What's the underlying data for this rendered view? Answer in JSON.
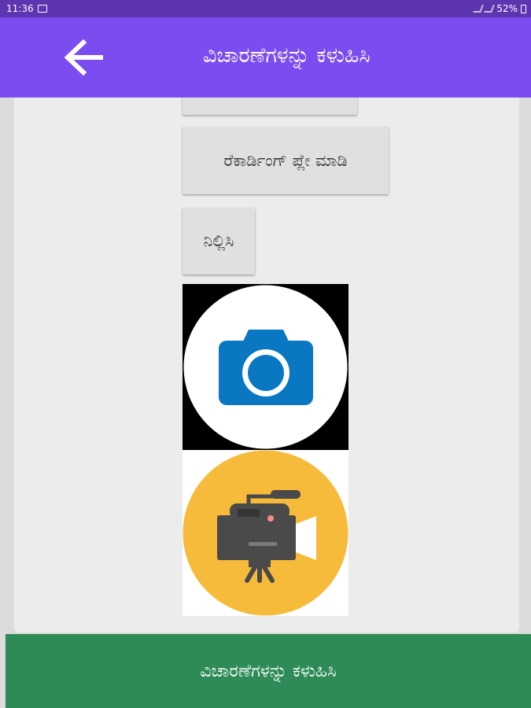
{
  "status_bar": {
    "time": "11:36",
    "battery": "52%",
    "image_icon": "image-icon",
    "wifi_icon": "wifi-icon",
    "signal_icon": "signal-icon",
    "battery_icon": "battery-icon"
  },
  "app_bar": {
    "title": "ವಿಚಾರಣೆಗಳನ್ನು ಕಳುಹಿಸಿ",
    "back_icon": "arrow-left-icon",
    "color": "#7b4cf0"
  },
  "buttons": {
    "partial_label": "",
    "play_recording": "ರೆಕಾರ್ಡಿಂಗ್ ಪ್ಲೇ ಮಾಡಿ",
    "stop": "ನಿಲ್ಲಿಸಿ"
  },
  "media": {
    "camera_icon": "camera-icon",
    "video_icon": "video-camera-icon"
  },
  "bottom_button": {
    "label": "ವಿಚಾರಣೆಗಳನ್ನು ಕಳುಹಿಸಿ",
    "color": "#2e8b57"
  }
}
